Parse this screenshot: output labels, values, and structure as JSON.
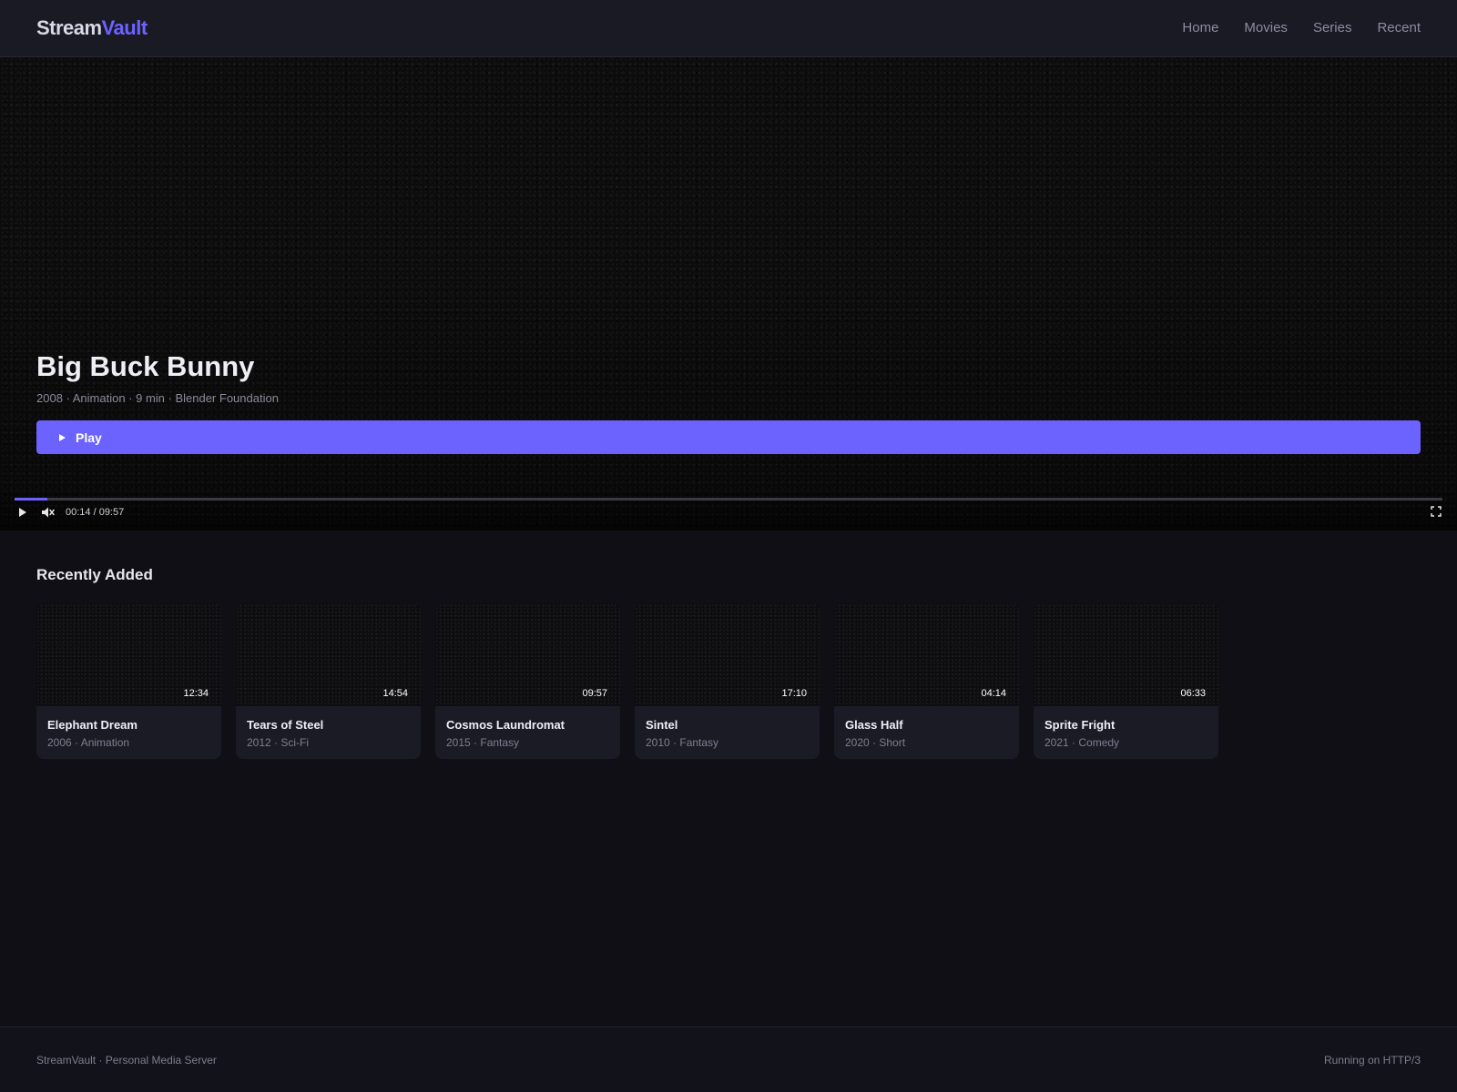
{
  "brand": {
    "part1": "Stream",
    "part2": "Vault",
    "accent": "#6c63ff"
  },
  "nav": {
    "items": [
      "Home",
      "Movies",
      "Series",
      "Recent"
    ]
  },
  "hero": {
    "title": "Big Buck Bunny",
    "meta": "2008 · Animation · 9 min · Blender Foundation",
    "play_label": "Play"
  },
  "player": {
    "current_time": "00:14",
    "duration": "09:57",
    "time_display": "00:14 / 09:57",
    "progress_fraction": 0.023,
    "muted": true,
    "icons": {
      "play": "play-icon",
      "mute": "muted-speaker-icon",
      "fullscreen": "fullscreen-icon"
    }
  },
  "recent": {
    "title": "Recently Added",
    "items": [
      {
        "title": "Elephant Dream",
        "sub": "2006 · Animation",
        "duration": "12:34"
      },
      {
        "title": "Tears of Steel",
        "sub": "2012 · Sci-Fi",
        "duration": "14:54"
      },
      {
        "title": "Cosmos Laundromat",
        "sub": "2015 · Fantasy",
        "duration": "09:57"
      },
      {
        "title": "Sintel",
        "sub": "2010 · Fantasy",
        "duration": "17:10"
      },
      {
        "title": "Glass Half",
        "sub": "2020 · Short",
        "duration": "04:14"
      },
      {
        "title": "Sprite Fright",
        "sub": "2021 · Comedy",
        "duration": "06:33"
      }
    ]
  },
  "footer": {
    "left": "StreamVault · Personal Media Server",
    "right": "Running on HTTP/3"
  }
}
